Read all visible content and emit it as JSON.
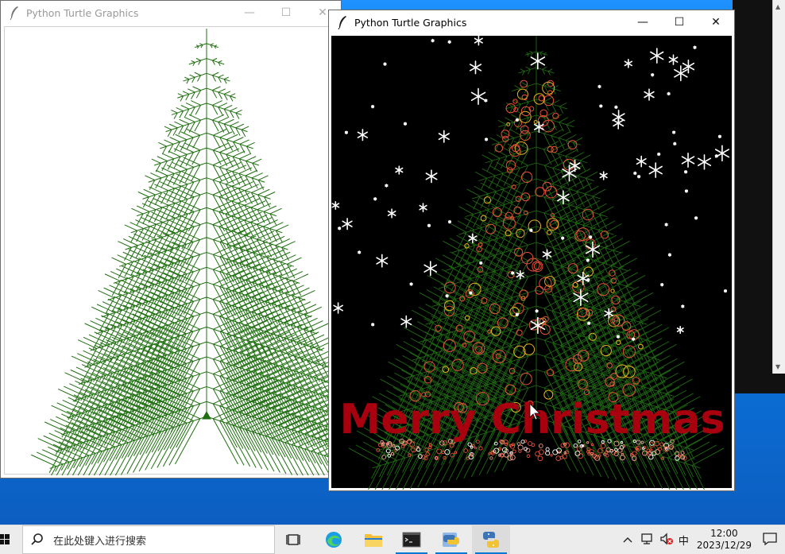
{
  "window_left": {
    "title": "Python Turtle Graphics"
  },
  "window_right": {
    "title": "Python Turtle Graphics",
    "greeting": "Merry Christmas"
  },
  "taskbar": {
    "search_placeholder": "在此处键入进行搜索",
    "ime_label": "中",
    "time": "12:00",
    "date": "2023/12/29"
  },
  "colors": {
    "tree_green": "#1f6f10",
    "text_red": "#a8000e",
    "taskbar_accent": "#0078d4"
  }
}
